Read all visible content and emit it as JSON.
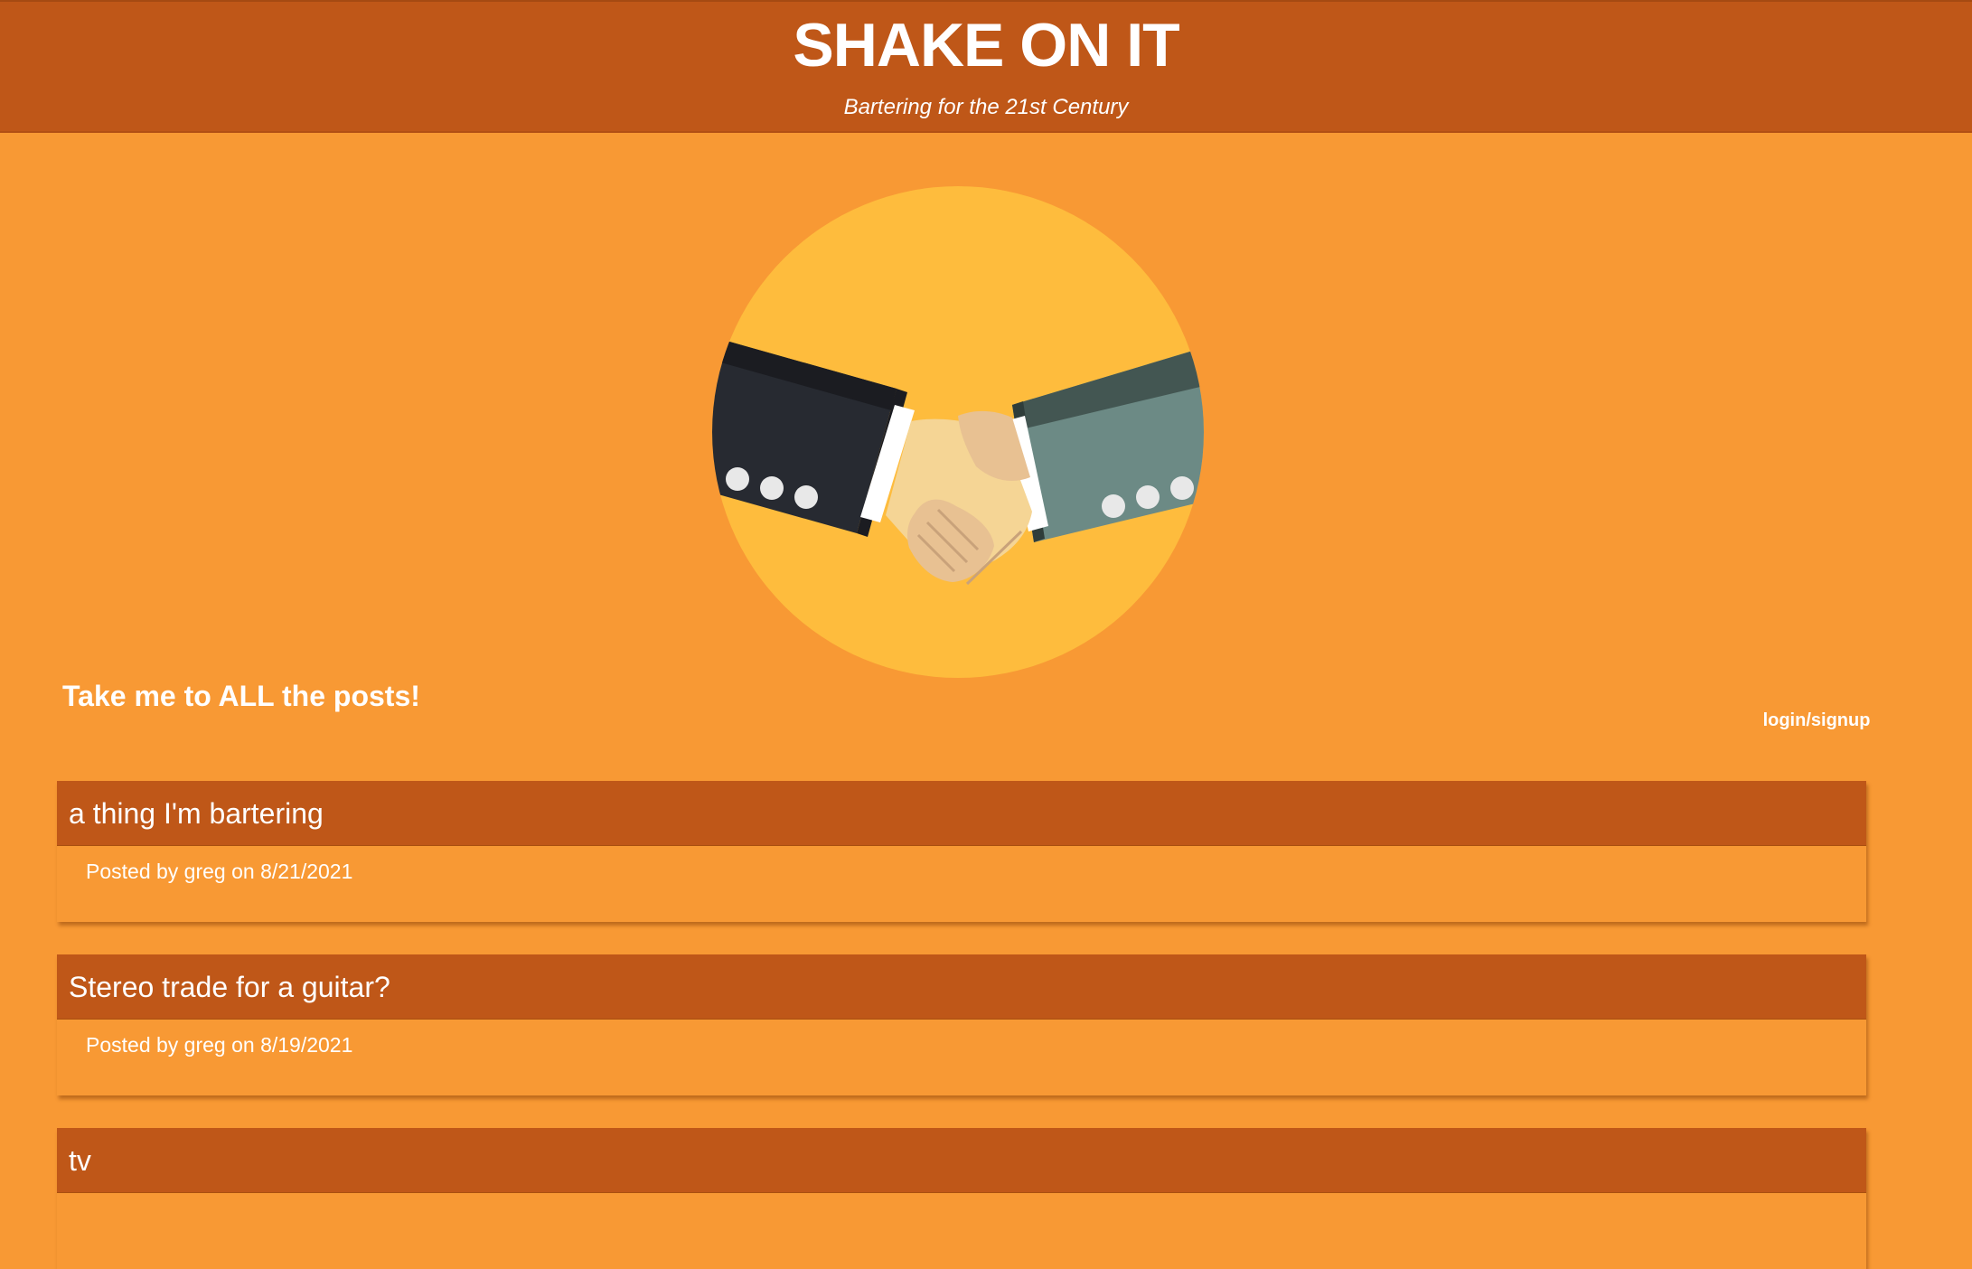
{
  "header": {
    "title": "SHAKE ON IT",
    "tagline": "Bartering for the 21st Century"
  },
  "hero": {
    "image": "handshake-illustration",
    "colors": {
      "circle": "#febc3d",
      "left_sleeve": "#272a31",
      "right_sleeve": "#6c8a85",
      "hand": "#f5d595"
    }
  },
  "nav": {
    "all_posts": "Take me to ALL the posts!",
    "login": "login/signup"
  },
  "posts": [
    {
      "title": "a thing I'm bartering",
      "author": "greg",
      "date": "8/21/2021",
      "meta": "Posted by greg on 8/21/2021"
    },
    {
      "title": "Stereo trade for a guitar?",
      "author": "greg",
      "date": "8/19/2021",
      "meta": "Posted by greg on 8/19/2021"
    },
    {
      "title": "tv",
      "author": "",
      "date": "",
      "meta": ""
    }
  ],
  "colors": {
    "background": "#f89934",
    "header": "#bf5718",
    "text": "#ffffff"
  }
}
